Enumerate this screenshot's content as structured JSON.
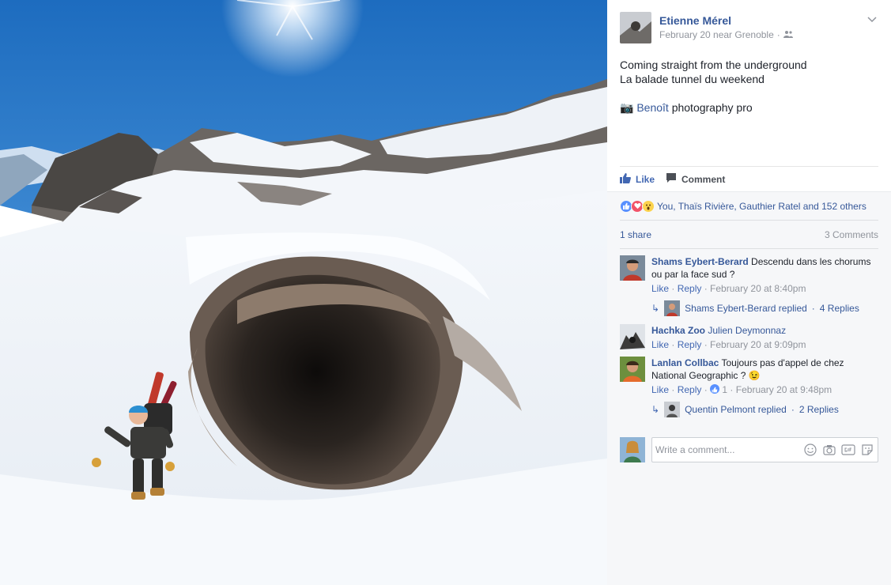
{
  "post": {
    "author": "Etienne Mérel",
    "date": "February 20 near Grenoble",
    "caption_line1": "Coming straight from the underground",
    "caption_line2": "La balade tunnel du weekend",
    "credit_emoji": "📷",
    "credit_name": "Benoît",
    "credit_text": " photography pro"
  },
  "actions": {
    "like_label": "Like",
    "comment_label": "Comment"
  },
  "reactions": {
    "text": "You, Thaïs Rivière, Gauthier Ratel and 152 others"
  },
  "shares": {
    "shares_text": "1 share",
    "comments_count": "3 Comments"
  },
  "comments": [
    {
      "author": "Shams Eybert-Berard",
      "text": " Descendu dans les chorums ou par la face sud ?",
      "like": "Like",
      "reply": "Reply",
      "time": "February 20 at 8:40pm",
      "reply_summary": "Shams Eybert-Berard replied",
      "reply_count": "4 Replies"
    },
    {
      "author": "Hachka Zoo",
      "mention": "Julien Deymonnaz",
      "like": "Like",
      "reply": "Reply",
      "time": "February 20 at 9:09pm"
    },
    {
      "author": "Lanlan Collbac",
      "text": " Toujours pas d'appel de chez National Geographic ? ",
      "emoji": "😉",
      "like": "Like",
      "reply": "Reply",
      "like_count": "1",
      "time": "February 20 at 9:48pm",
      "reply_summary": "Quentin Pelmont replied",
      "reply_count": "2 Replies"
    }
  ],
  "composer": {
    "placeholder": "Write a comment..."
  },
  "colors": {
    "link": "#365899",
    "like_blue": "#4267b2",
    "meta_gray": "#90949c",
    "panel_bg": "#f6f7f9"
  }
}
